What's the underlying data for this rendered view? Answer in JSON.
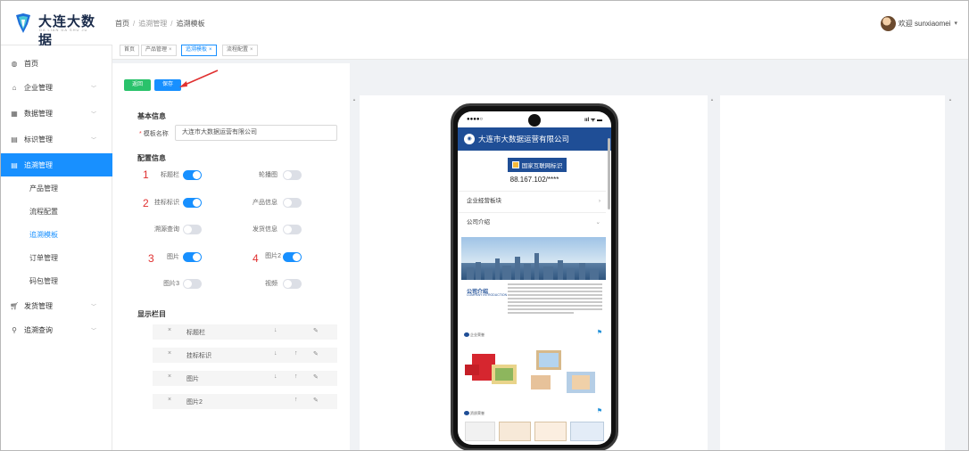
{
  "header": {
    "logo_text": "大连大数据",
    "logo_sub": "DA LIAN DA SHU JU",
    "breadcrumb": [
      "首页",
      "追溯管理",
      "追溯模板"
    ],
    "user_text": "欢迎 sunxiaomei"
  },
  "tabs": [
    {
      "label": "首页",
      "closable": false
    },
    {
      "label": "产品管理",
      "closable": true
    },
    {
      "label": "追溯模板",
      "closable": true,
      "active": true
    },
    {
      "label": "流程配置",
      "closable": true
    }
  ],
  "sidebar": {
    "items": [
      {
        "label": "首页",
        "icon": "dashboard-icon"
      },
      {
        "label": "企业管理",
        "icon": "home-icon"
      },
      {
        "label": "数据管理",
        "icon": "grid-icon"
      },
      {
        "label": "标识管理",
        "icon": "document-icon"
      },
      {
        "label": "追溯管理",
        "icon": "document-icon",
        "active": true
      },
      {
        "label": "发货管理",
        "icon": "cart-icon"
      },
      {
        "label": "追溯查询",
        "icon": "search-icon"
      }
    ],
    "sub_items": [
      {
        "label": "产品管理"
      },
      {
        "label": "流程配置"
      },
      {
        "label": "追溯模板",
        "active": true
      },
      {
        "label": "订单管理"
      },
      {
        "label": "码包管理"
      }
    ]
  },
  "toolbar": {
    "back_label": "返回",
    "save_label": "保存"
  },
  "form": {
    "basic_title": "基本信息",
    "template_name_label": "模板名称",
    "template_name_value": "大连市大数据运营有限公司",
    "config_title": "配置信息",
    "switches": [
      {
        "label": "标题栏",
        "on": true,
        "anno": "1"
      },
      {
        "label": "轮播图",
        "on": false
      },
      {
        "label": "挂标标识",
        "on": true,
        "anno": "2"
      },
      {
        "label": "产品信息",
        "on": false
      },
      {
        "label": "溯源查询",
        "on": false
      },
      {
        "label": "发货信息",
        "on": false
      },
      {
        "label": "图片",
        "on": true,
        "anno": "3"
      },
      {
        "label": "图片2",
        "on": true,
        "anno": "4"
      },
      {
        "label": "图片3",
        "on": false
      },
      {
        "label": "视频",
        "on": false
      }
    ],
    "display_title": "显示栏目",
    "columns": [
      {
        "label": "标题栏",
        "down": true,
        "up": false
      },
      {
        "label": "挂标标识",
        "down": true,
        "up": true
      },
      {
        "label": "图片",
        "down": true,
        "up": true
      },
      {
        "label": "图片2",
        "down": false,
        "up": true
      }
    ]
  },
  "phone": {
    "status_left": "●●●●○",
    "status_right": "ııl ᯤ ▬",
    "company": "大连市大数据运营有限公司",
    "id_button": "国家互联网标识",
    "id_number": "88.167.102/****",
    "rows": [
      {
        "label": "企业经营板块",
        "arrow": "›"
      },
      {
        "label": "公司介绍",
        "arrow": "⌄"
      }
    ],
    "intro_title": "公司介绍",
    "intro_sub": "COMPANY INTRODUCTION",
    "section1": "企业荣誉",
    "section2": "资质荣誉"
  },
  "colors": {
    "primary": "#1890ff",
    "success": "#2ac26b",
    "phone_header": "#1f4e96"
  }
}
